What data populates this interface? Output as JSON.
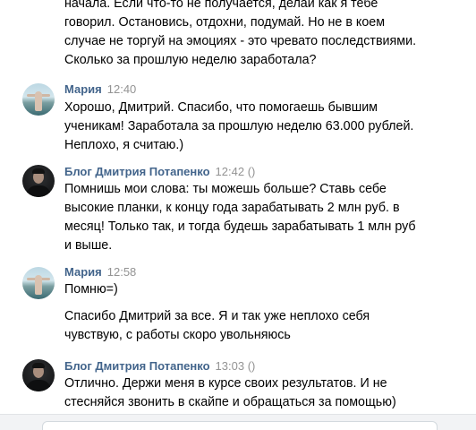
{
  "top_message": {
    "lines": [
      "начала. Если что-то не получается, делай как я тебе",
      "говорил. Остановись, отдохни, подумай. Но не в коем",
      "случае не торгуй на эмоциях - это чревато последствиями.",
      "Сколько за прошлую неделю заработала?"
    ]
  },
  "messages": [
    {
      "author": "Мария",
      "time": "12:40",
      "avatar_icon": "user-avatar-photo",
      "lines": [
        "Хорошо, Дмитрий. Спасибо, что помогаешь бывшим",
        "ученикам! Заработала за прошлую неделю 63.000 рублей.",
        "Неплохо, я считаю.)"
      ]
    },
    {
      "author": "Блог Дмитрия Потапенко",
      "time": "12:42 ()",
      "avatar_icon": "user-avatar-photo",
      "lines": [
        "Помнишь мои слова: ты можешь больше? Ставь себе",
        "высокие планки, к концу года зарабатывать 2 млн руб. в",
        "месяц! Только так, и тогда будешь зарабатывать 1 млн руб",
        "и выше."
      ]
    },
    {
      "author": "Мария",
      "time": "12:58",
      "avatar_icon": "user-avatar-photo",
      "lines": [
        "Помню=)"
      ],
      "followup_lines": [
        "Спасибо Дмитрий за все. Я и так уже неплохо себя",
        "чувствую, с работы скоро увольняюсь"
      ]
    },
    {
      "author": "Блог Дмитрия Потапенко",
      "time": "13:03 ()",
      "avatar_icon": "user-avatar-photo",
      "lines": [
        "Отлично. Держи меня в курсе своих результатов. И не",
        "стесняйся звонить в скайпе и обращаться за помощью)"
      ]
    }
  ],
  "composer": {
    "placeholder": ""
  },
  "colors": {
    "author": "#42648b",
    "time": "#939393",
    "text": "#000000",
    "background": "#ffffff"
  }
}
